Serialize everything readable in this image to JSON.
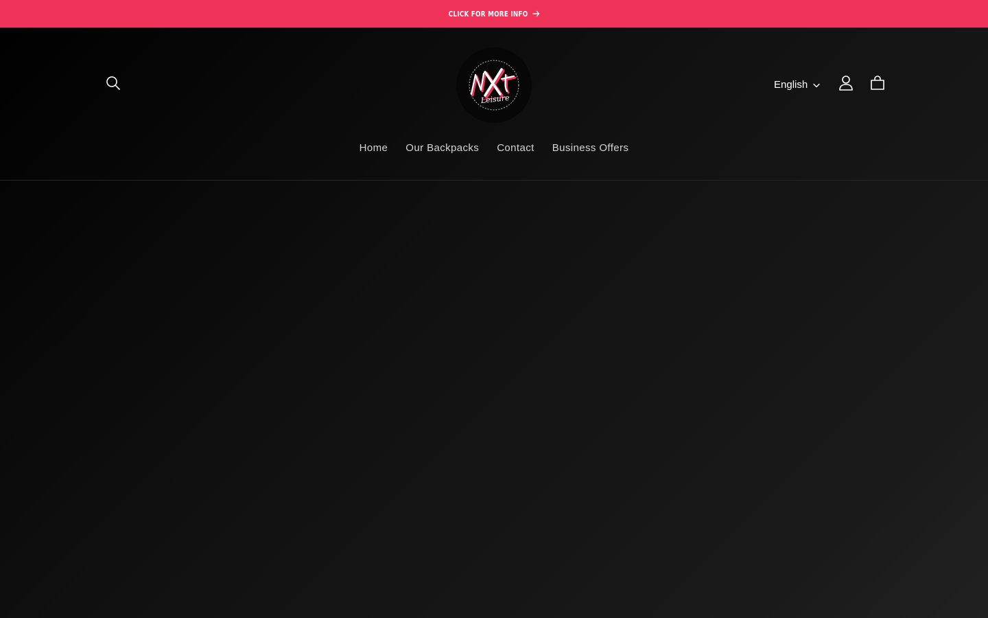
{
  "announcement": {
    "text": "CLICK FOR MORE INFO",
    "icon": "arrow-right-icon",
    "background": "#ef3359"
  },
  "header": {
    "search_icon": "search-icon",
    "logo_text": "NXt Leisure",
    "language": "English",
    "account_icon": "user-icon",
    "cart_icon": "cart-icon"
  },
  "nav": {
    "items": [
      {
        "label": "Home"
      },
      {
        "label": "Our Backpacks"
      },
      {
        "label": "Contact"
      },
      {
        "label": "Business Offers"
      }
    ]
  },
  "colors": {
    "accent": "#ef3359",
    "background": "#111111",
    "text": "#ffffff",
    "nav_text": "#d4d4d4"
  }
}
